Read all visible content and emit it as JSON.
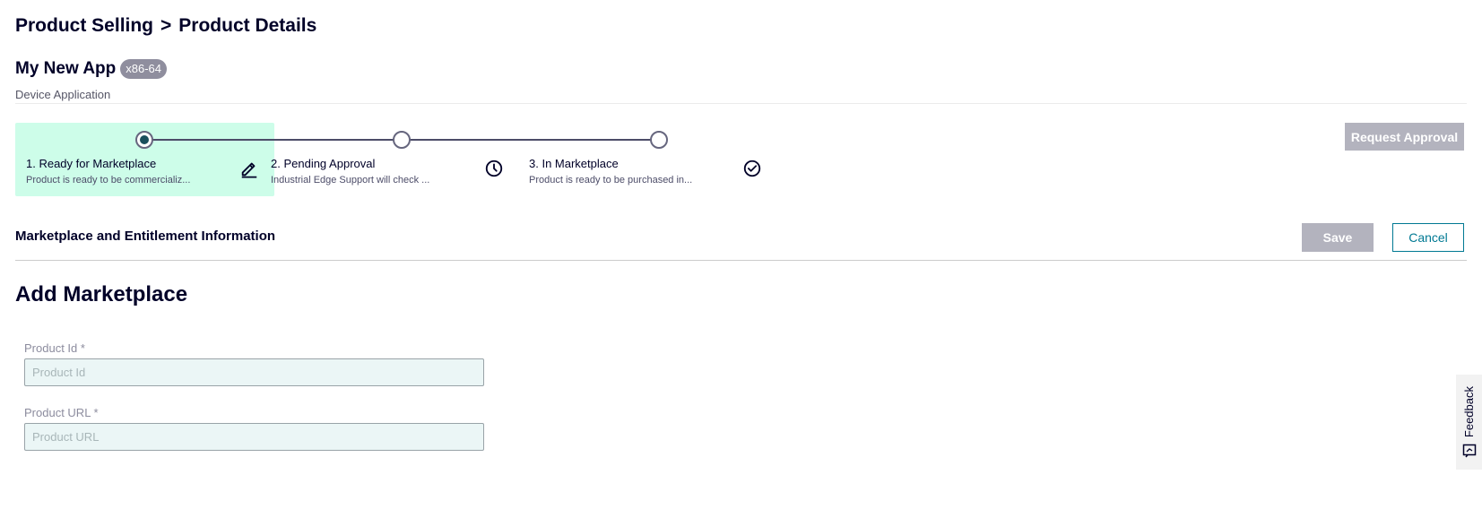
{
  "breadcrumb": {
    "parent": "Product Selling",
    "separator": ">",
    "current": "Product Details"
  },
  "app": {
    "name": "My New App",
    "arch_badge": "x86-64",
    "type": "Device Application"
  },
  "stepper": {
    "steps": [
      {
        "label": "1. Ready for Marketplace",
        "description": "Product is ready to be commercializ...",
        "icon": "pencil-icon",
        "active": true
      },
      {
        "label": "2. Pending Approval",
        "description": "Industrial Edge Support will check ...",
        "icon": "clock-icon",
        "active": false
      },
      {
        "label": "3. In Marketplace",
        "description": "Product is ready to be purchased in...",
        "icon": "check-circle-icon",
        "active": false
      }
    ]
  },
  "actions": {
    "request_approval": "Request Approval",
    "save": "Save",
    "cancel": "Cancel"
  },
  "section": {
    "title": "Marketplace and Entitlement Information"
  },
  "form": {
    "title": "Add Marketplace",
    "product_id": {
      "label": "Product Id *",
      "placeholder": "Product Id",
      "value": ""
    },
    "product_url": {
      "label": "Product URL *",
      "placeholder": "Product URL",
      "value": ""
    }
  },
  "feedback": {
    "label": "Feedback",
    "icon": "feedback-icon"
  },
  "colors": {
    "active_step_bg": "#cdfde9",
    "disabled_button": "#b3b3be",
    "accent": "#007993",
    "badge_bg": "#8f8e9e",
    "input_bg": "#ebf6f6"
  }
}
